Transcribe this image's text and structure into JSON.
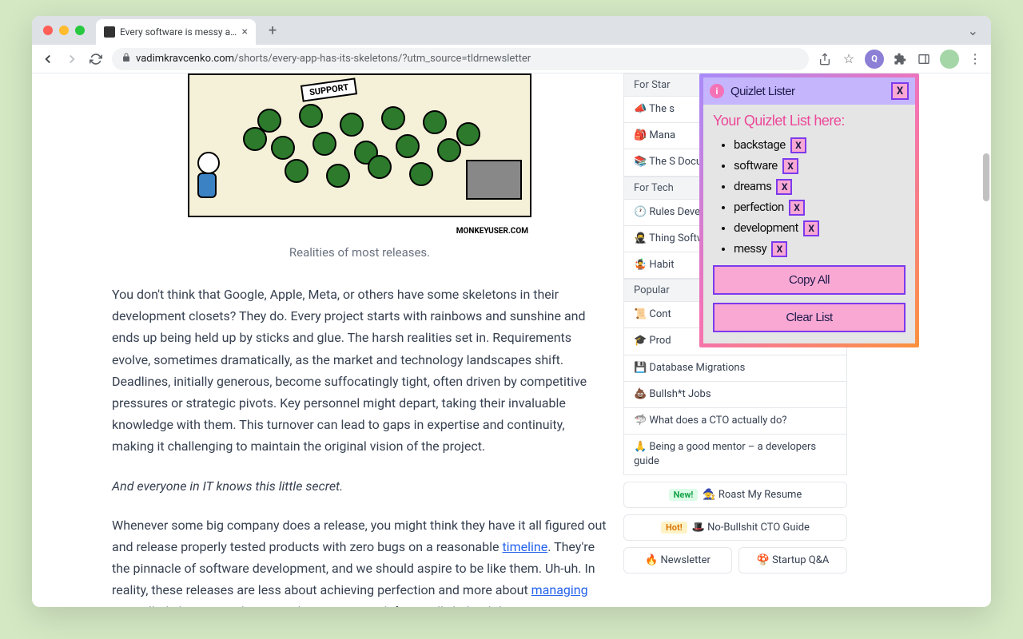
{
  "browser": {
    "tab_title": "Every software is messy and h",
    "url_domain": "vadimkravcenko.com",
    "url_path": "/shorts/every-app-has-its-skeletons/?utm_source=tldrnewsletter"
  },
  "comic": {
    "support_label": "SUPPORT",
    "attribution": "MONKEYUSER.COM",
    "caption": "Realities of most releases."
  },
  "article": {
    "p1": "You don't think that Google, Apple, Meta, or others have some skeletons in their development closets? They do. Every project starts with rainbows and sunshine and ends up being held up by sticks and glue. The harsh realities set in. Requirements evolve, sometimes dramatically, as the market and technology landscapes shift. Deadlines, initially generous, become suffocatingly tight, often driven by competitive pressures or strategic pivots. Key personnel might depart, taking their invaluable knowledge with them. This turnover can lead to gaps in expertise and continuity, making it challenging to maintain the original vision of the project.",
    "p2": "And everyone in IT knows this little secret.",
    "p3_a": "Whenever some big company does a release, you might think they have it all figured out and release properly tested products with zero bugs on a reasonable ",
    "p3_link1": "timeline",
    "p3_b": ". They're the pinnacle of software development, and we should aspire to be like them. Uh-uh. In reality, these releases are less about achieving perfection and more about ",
    "p3_link2": "managing",
    "p3_c": " controlled chaos. Developers and engineers work frantically behind-the-scenes to squash last-minute"
  },
  "sidebar": {
    "sections": {
      "s1": "For Star",
      "s2": "For Tech",
      "s3": "Popular"
    },
    "items": {
      "i1": "📣 The s",
      "i2": "🎒 Mana",
      "i3": "📚 The S Docume",
      "i4": "🕐 Rules Develop",
      "i5": "🥷 Thing Software",
      "i6": "🤹 Habit",
      "i7": "📜 Cont",
      "i8": "🎓 Prod",
      "i9": "💾 Database Migrations",
      "i10": "💩 Bullsh*t Jobs",
      "i11": "🦈 What does a CTO actually do?",
      "i12": "🙏 Being a good mentor – a developers guide"
    },
    "buttons": {
      "new_badge": "New!",
      "hot_badge": "Hot!",
      "roast": "🧙 Roast My Resume",
      "cto": "🎩 No-Bullshit CTO Guide",
      "newsletter": "🔥 Newsletter",
      "qa": "🍄 Startup Q&A"
    }
  },
  "quizlet": {
    "title": "Quizlet Lister",
    "heading": "Your Quizlet List here:",
    "items": [
      "backstage",
      "software",
      "dreams",
      "perfection",
      "development",
      "messy"
    ],
    "x": "X",
    "copy_btn": "Copy All",
    "clear_btn": "Clear List",
    "info": "i"
  }
}
